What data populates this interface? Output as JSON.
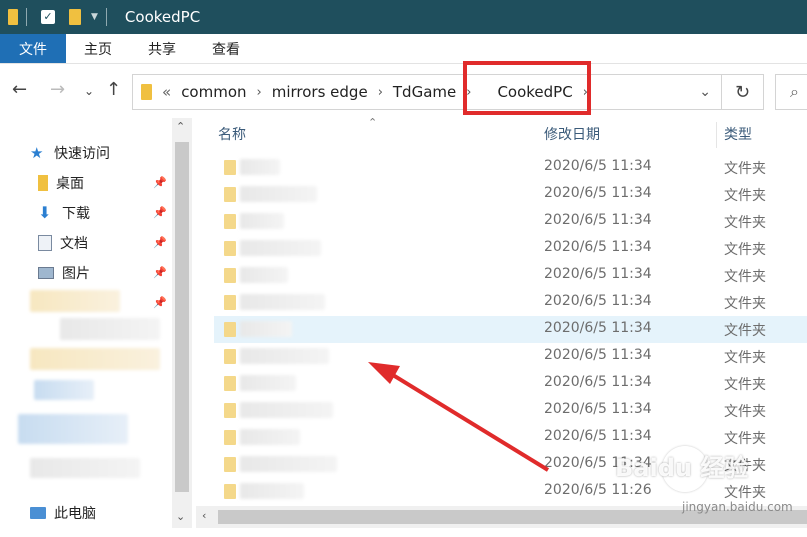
{
  "window": {
    "title": "CookedPC"
  },
  "ribbon": {
    "tabs": [
      "文件",
      "主页",
      "共享",
      "查看"
    ]
  },
  "address": {
    "back_icon": "left-arrow-icon",
    "forward_icon": "right-arrow-icon",
    "up_icon": "up-arrow-icon",
    "overflow": "«",
    "crumbs": [
      "common",
      "mirrors edge",
      "TdGame",
      "CookedPC"
    ],
    "refresh_icon": "refresh-icon",
    "search_icon": "search-icon"
  },
  "nav": {
    "quick_access": "快速访问",
    "items": [
      {
        "label": "桌面",
        "icon": "desktop-folder-icon"
      },
      {
        "label": "下载",
        "icon": "download-icon"
      },
      {
        "label": "文档",
        "icon": "document-icon"
      },
      {
        "label": "图片",
        "icon": "pictures-icon"
      }
    ],
    "this_pc": "此电脑"
  },
  "columns": {
    "name": "名称",
    "date": "修改日期",
    "type": "类型"
  },
  "rows": [
    {
      "date": "2020/6/5 11:34",
      "type": "文件夹"
    },
    {
      "date": "2020/6/5 11:34",
      "type": "文件夹"
    },
    {
      "date": "2020/6/5 11:34",
      "type": "文件夹"
    },
    {
      "date": "2020/6/5 11:34",
      "type": "文件夹"
    },
    {
      "date": "2020/6/5 11:34",
      "type": "文件夹"
    },
    {
      "date": "2020/6/5 11:34",
      "type": "文件夹"
    },
    {
      "date": "2020/6/5 11:34",
      "type": "文件夹"
    },
    {
      "date": "2020/6/5 11:34",
      "type": "文件夹"
    },
    {
      "date": "2020/6/5 11:34",
      "type": "文件夹"
    },
    {
      "date": "2020/6/5 11:34",
      "type": "文件夹"
    },
    {
      "date": "2020/6/5 11:34",
      "type": "文件夹"
    },
    {
      "date": "2020/6/5 11:34",
      "type": "文件夹"
    },
    {
      "date": "2020/6/5 11:26",
      "type": "文件夹"
    }
  ],
  "watermark": {
    "brand": "Baidu 经验",
    "url": "jingyan.baidu.com"
  },
  "colors": {
    "titlebar": "#1f4f5d",
    "file_tab": "#1f6fb5",
    "highlight": "#e02b2b",
    "selected_row": "#e5f3fb"
  }
}
